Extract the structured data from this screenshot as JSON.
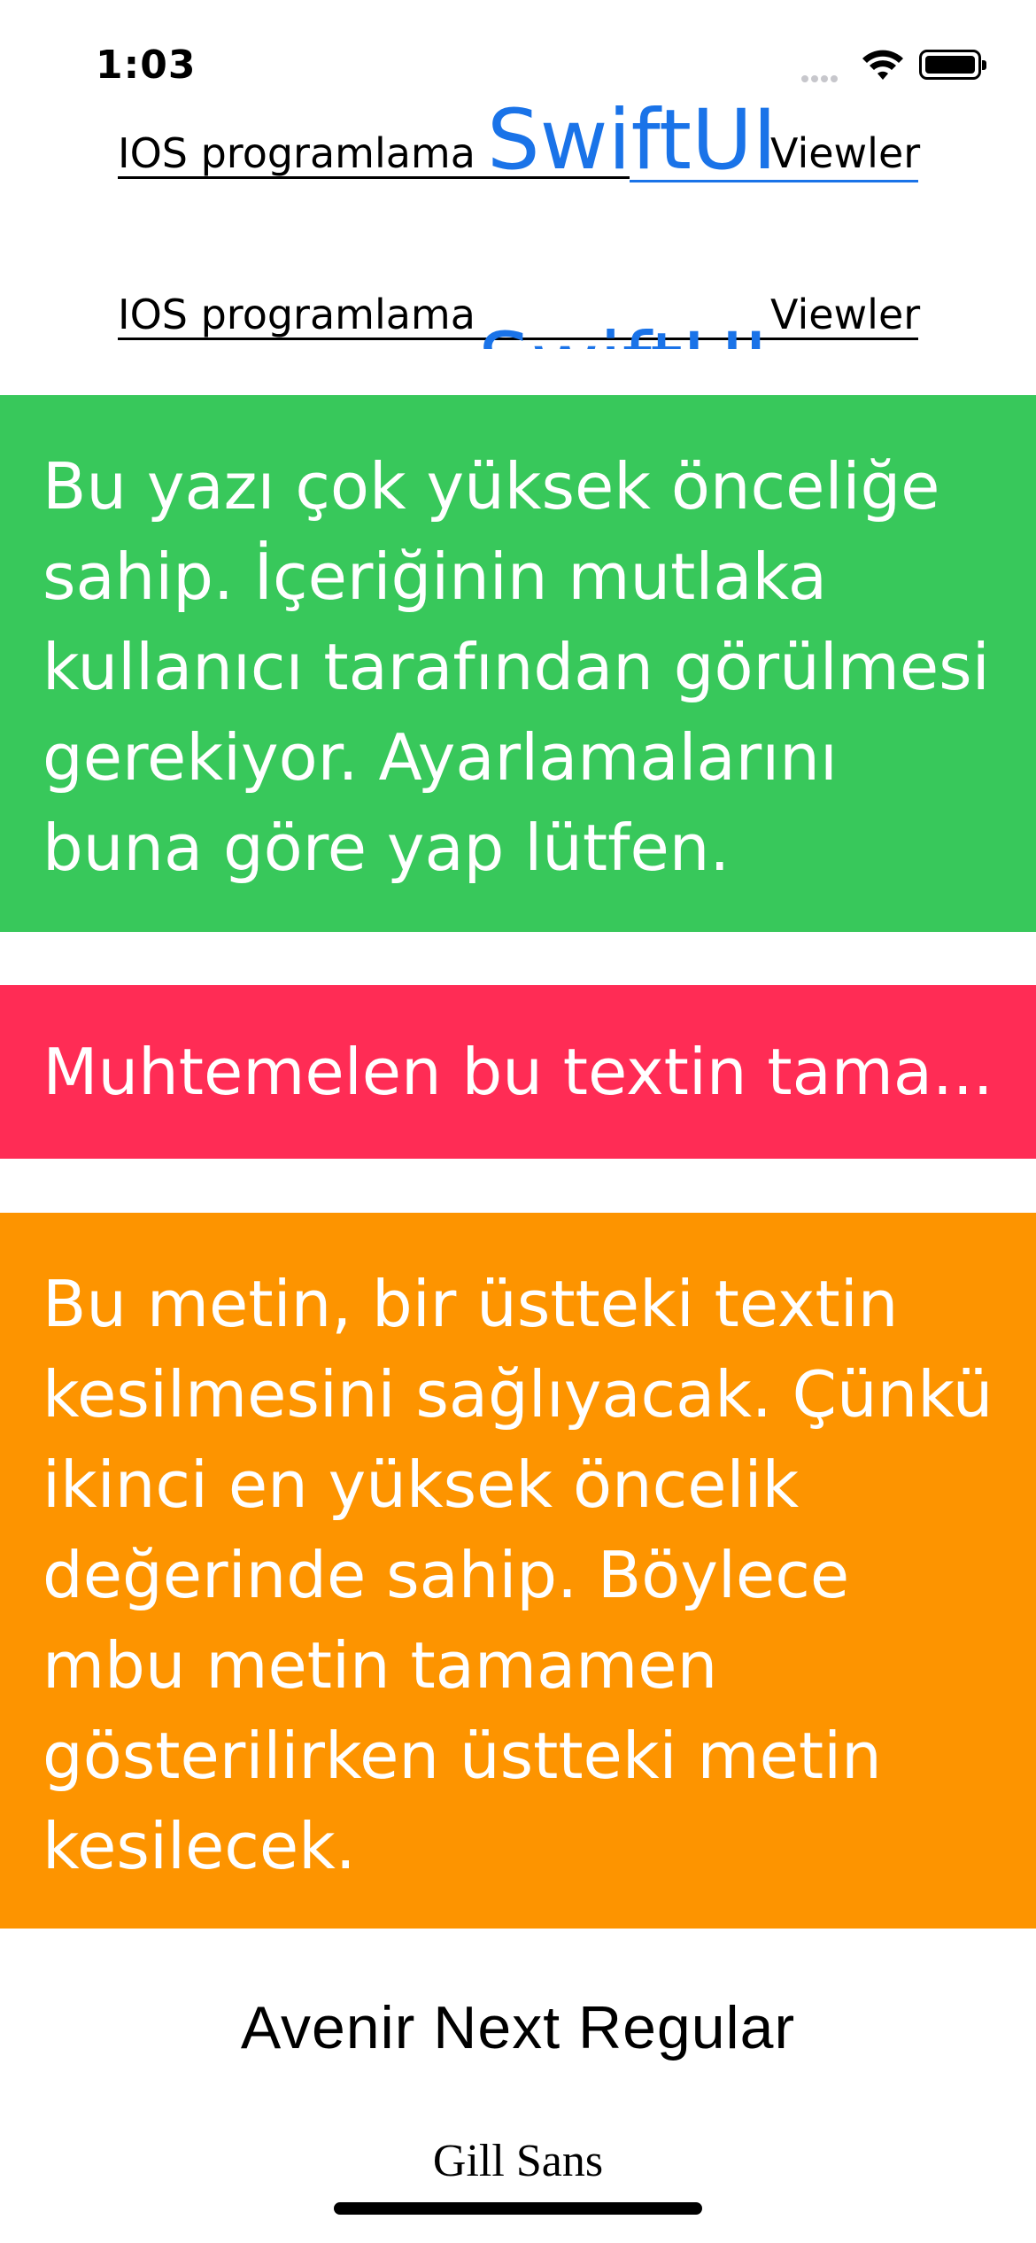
{
  "status_bar": {
    "time": "1:03"
  },
  "row1": {
    "left": "IOS programlama",
    "center": "SwiftUI",
    "right": "Viewler"
  },
  "row2": {
    "left": "IOS programlama",
    "center": "SwiftUI",
    "right": "Viewler"
  },
  "blocks": {
    "green_text": "Bu yazı çok yüksek önceliğe sahip. İçeriğinin mutlaka kullanıcı tarafından görülmesi gerekiyor. Ayarlamalarını buna göre yap lütfen.",
    "red_text": "Muhtemelen bu textin tama...",
    "orange_text": "Bu metin, bir üstteki textin kesilmesini sağlıyacak. Çünkü ikinci en yüksek öncelik değerinde sahip. Böylece mbu metin tamamen gösterilirken üstteki metin kesilecek."
  },
  "font_labels": {
    "avenir": "Avenir Next Regular",
    "gill": "Gill Sans"
  },
  "colors": {
    "green": "#38c85b",
    "red": "#ff2c55",
    "orange": "#fd9400",
    "accent_blue": "#1a73e8"
  },
  "icons": [
    "cellular-signal-icon",
    "wifi-icon",
    "battery-icon"
  ]
}
